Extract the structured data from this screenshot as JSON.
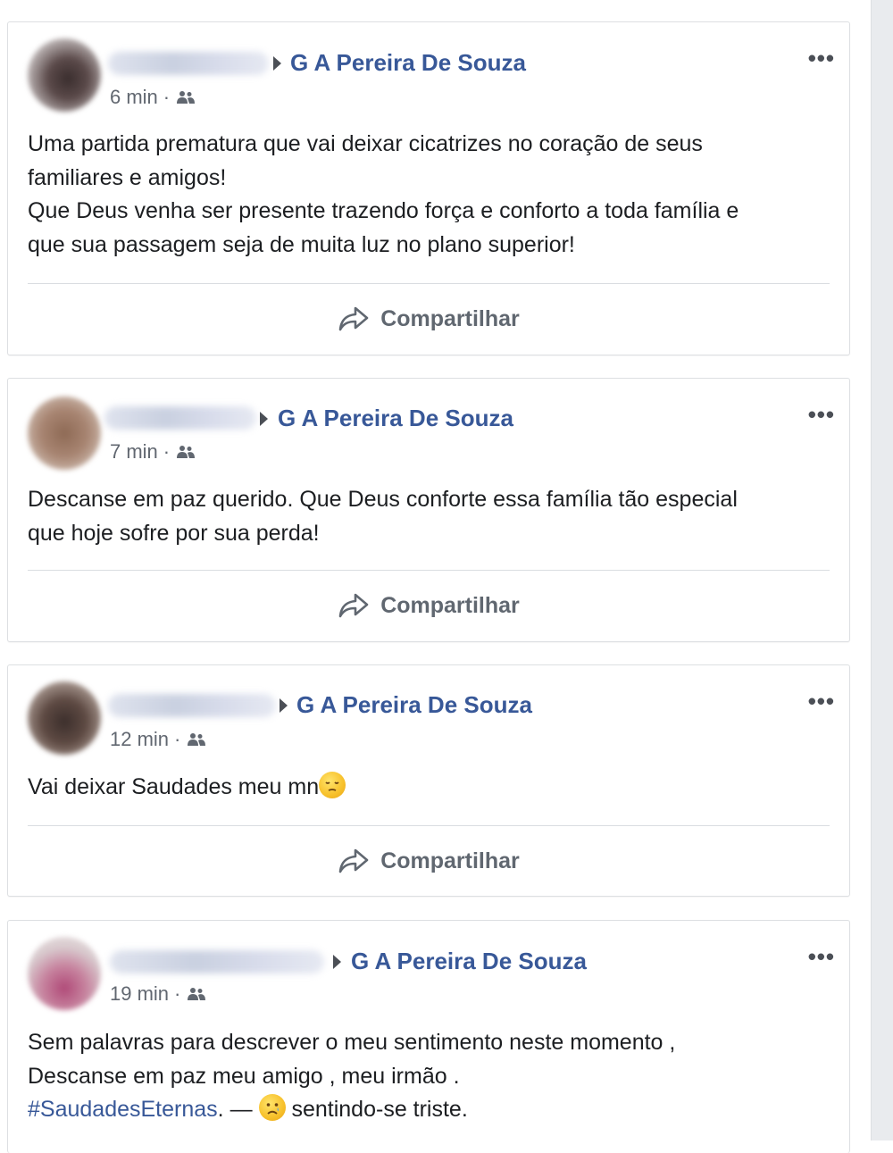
{
  "posts": [
    {
      "group": "G A Pereira De Souza",
      "time": "6 min",
      "separator": "·",
      "text_lines": [
        "Uma partida prematura que vai deixar cicatrizes no coração de seus",
        "familiares e amigos!",
        "Que Deus venha ser presente trazendo força e conforto a toda família e",
        "que sua passagem seja de muita luz no plano superior!"
      ],
      "share_label": "Compartilhar",
      "more_label": "•••"
    },
    {
      "group": "G A Pereira De Souza",
      "time": "7 min",
      "separator": "·",
      "text_lines": [
        "Descanse em paz querido. Que Deus conforte essa família tão especial",
        "que hoje sofre por sua perda!"
      ],
      "share_label": "Compartilhar",
      "more_label": "•••"
    },
    {
      "group": "G A Pereira De Souza",
      "time": "12 min",
      "separator": "·",
      "text": "Vai deixar Saudades meu mn",
      "emoji": "pensive-face",
      "share_label": "Compartilhar",
      "more_label": "•••"
    },
    {
      "group": "G A Pereira De Souza",
      "time": "19 min",
      "separator": "·",
      "text_lines": [
        "Sem palavras para descrever o meu sentimento neste momento ,",
        "Descanse em paz meu amigo , meu irmão ."
      ],
      "hashtag": "#SaudadesEternas",
      "feeling_prefix": ". — ",
      "feeling_emoji": "sad-face",
      "feeling_text": "sentindo-se triste.",
      "more_label": "•••"
    }
  ],
  "icons": {
    "audience": "people-icon",
    "share": "share-arrow-icon",
    "more": "more-options-icon",
    "caret": "caret-right-icon"
  },
  "colors": {
    "link_blue": "#385898",
    "text": "#1c1e21",
    "meta_gray": "#616770",
    "border": "#dddfe2"
  }
}
